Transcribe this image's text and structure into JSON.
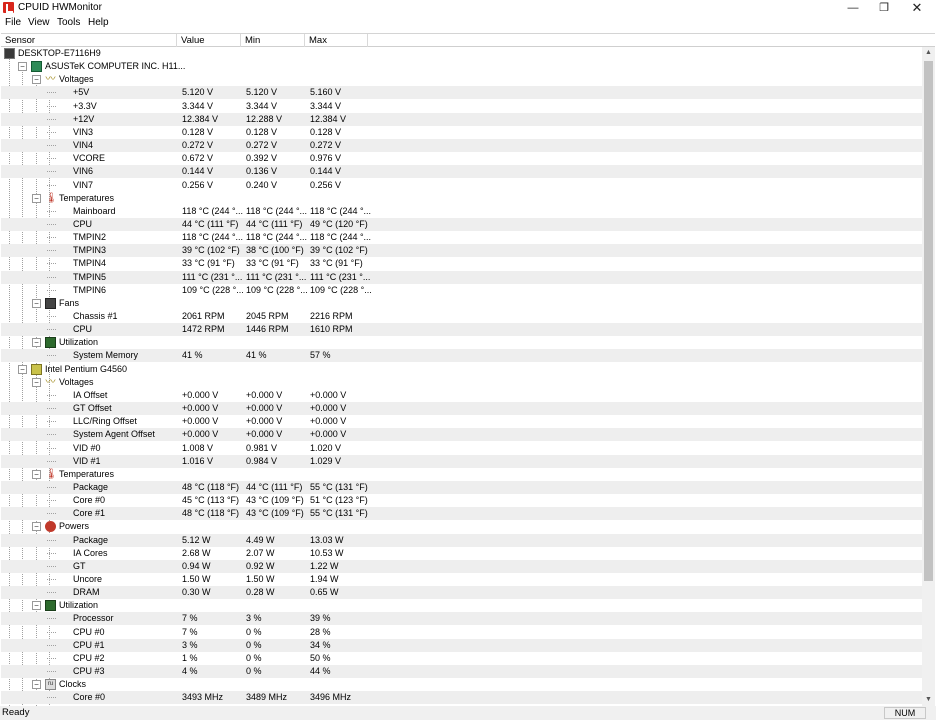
{
  "window": {
    "title": "CPUID HWMonitor",
    "minimize": "—",
    "maximize": "❐",
    "close": "✕"
  },
  "menu": [
    "File",
    "View",
    "Tools",
    "Help"
  ],
  "columns": [
    "Sensor",
    "Value",
    "Min",
    "Max"
  ],
  "rows": [
    {
      "d": 0,
      "k": "d",
      "ic": "pc",
      "l": "DESKTOP-E7116H9"
    },
    {
      "d": 1,
      "k": "d",
      "ic": "mb",
      "l": "ASUSTeK COMPUTER INC. H11..."
    },
    {
      "d": 2,
      "k": "g",
      "ic": "volt",
      "l": "Voltages"
    },
    {
      "d": 3,
      "k": "s",
      "l": "+5V",
      "v": "5.120 V",
      "mn": "5.120 V",
      "mx": "5.160 V"
    },
    {
      "d": 3,
      "k": "s",
      "l": "+3.3V",
      "v": "3.344 V",
      "mn": "3.344 V",
      "mx": "3.344 V"
    },
    {
      "d": 3,
      "k": "s",
      "l": "+12V",
      "v": "12.384 V",
      "mn": "12.288 V",
      "mx": "12.384 V"
    },
    {
      "d": 3,
      "k": "s",
      "l": "VIN3",
      "v": "0.128 V",
      "mn": "0.128 V",
      "mx": "0.128 V"
    },
    {
      "d": 3,
      "k": "s",
      "l": "VIN4",
      "v": "0.272 V",
      "mn": "0.272 V",
      "mx": "0.272 V"
    },
    {
      "d": 3,
      "k": "s",
      "l": "VCORE",
      "v": "0.672 V",
      "mn": "0.392 V",
      "mx": "0.976 V"
    },
    {
      "d": 3,
      "k": "s",
      "l": "VIN6",
      "v": "0.144 V",
      "mn": "0.136 V",
      "mx": "0.144 V"
    },
    {
      "d": 3,
      "k": "s",
      "l": "VIN7",
      "v": "0.256 V",
      "mn": "0.240 V",
      "mx": "0.256 V"
    },
    {
      "d": 2,
      "k": "g",
      "ic": "temp",
      "l": "Temperatures"
    },
    {
      "d": 3,
      "k": "s",
      "l": "Mainboard",
      "v": "118 °C (244 °...",
      "mn": "118 °C (244 °...",
      "mx": "118 °C (244 °..."
    },
    {
      "d": 3,
      "k": "s",
      "l": "CPU",
      "v": "44 °C (111 °F)",
      "mn": "44 °C (111 °F)",
      "mx": "49 °C (120 °F)"
    },
    {
      "d": 3,
      "k": "s",
      "l": "TMPIN2",
      "v": "118 °C (244 °...",
      "mn": "118 °C (244 °...",
      "mx": "118 °C (244 °..."
    },
    {
      "d": 3,
      "k": "s",
      "l": "TMPIN3",
      "v": "39 °C (102 °F)",
      "mn": "38 °C (100 °F)",
      "mx": "39 °C (102 °F)"
    },
    {
      "d": 3,
      "k": "s",
      "l": "TMPIN4",
      "v": "33 °C (91 °F)",
      "mn": "33 °C (91 °F)",
      "mx": "33 °C (91 °F)"
    },
    {
      "d": 3,
      "k": "s",
      "l": "TMPIN5",
      "v": "111 °C (231 °...",
      "mn": "111 °C (231 °...",
      "mx": "111 °C (231 °..."
    },
    {
      "d": 3,
      "k": "s",
      "l": "TMPIN6",
      "v": "109 °C (228 °...",
      "mn": "109 °C (228 °...",
      "mx": "109 °C (228 °..."
    },
    {
      "d": 2,
      "k": "g",
      "ic": "fan",
      "l": "Fans"
    },
    {
      "d": 3,
      "k": "s",
      "l": "Chassis #1",
      "v": "2061 RPM",
      "mn": "2045 RPM",
      "mx": "2216 RPM"
    },
    {
      "d": 3,
      "k": "s",
      "l": "CPU",
      "v": "1472 RPM",
      "mn": "1446 RPM",
      "mx": "1610 RPM"
    },
    {
      "d": 2,
      "k": "g",
      "ic": "util",
      "l": "Utilization"
    },
    {
      "d": 3,
      "k": "s",
      "l": "System Memory",
      "v": "41 %",
      "mn": "41 %",
      "mx": "57 %"
    },
    {
      "d": 1,
      "k": "d",
      "ic": "cpu",
      "l": "Intel Pentium G4560"
    },
    {
      "d": 2,
      "k": "g",
      "ic": "volt",
      "l": "Voltages"
    },
    {
      "d": 3,
      "k": "s",
      "l": "IA Offset",
      "v": "+0.000 V",
      "mn": "+0.000 V",
      "mx": "+0.000 V"
    },
    {
      "d": 3,
      "k": "s",
      "l": "GT Offset",
      "v": "+0.000 V",
      "mn": "+0.000 V",
      "mx": "+0.000 V"
    },
    {
      "d": 3,
      "k": "s",
      "l": "LLC/Ring Offset",
      "v": "+0.000 V",
      "mn": "+0.000 V",
      "mx": "+0.000 V"
    },
    {
      "d": 3,
      "k": "s",
      "l": "System Agent Offset",
      "v": "+0.000 V",
      "mn": "+0.000 V",
      "mx": "+0.000 V"
    },
    {
      "d": 3,
      "k": "s",
      "l": "VID #0",
      "v": "1.008 V",
      "mn": "0.981 V",
      "mx": "1.020 V"
    },
    {
      "d": 3,
      "k": "s",
      "l": "VID #1",
      "v": "1.016 V",
      "mn": "0.984 V",
      "mx": "1.029 V"
    },
    {
      "d": 2,
      "k": "g",
      "ic": "temp",
      "l": "Temperatures"
    },
    {
      "d": 3,
      "k": "s",
      "l": "Package",
      "v": "48 °C (118 °F)",
      "mn": "44 °C (111 °F)",
      "mx": "55 °C (131 °F)"
    },
    {
      "d": 3,
      "k": "s",
      "l": "Core #0",
      "v": "45 °C (113 °F)",
      "mn": "43 °C (109 °F)",
      "mx": "51 °C (123 °F)"
    },
    {
      "d": 3,
      "k": "s",
      "l": "Core #1",
      "v": "48 °C (118 °F)",
      "mn": "43 °C (109 °F)",
      "mx": "55 °C (131 °F)"
    },
    {
      "d": 2,
      "k": "g",
      "ic": "power",
      "l": "Powers"
    },
    {
      "d": 3,
      "k": "s",
      "l": "Package",
      "v": "5.12 W",
      "mn": "4.49 W",
      "mx": "13.03 W"
    },
    {
      "d": 3,
      "k": "s",
      "l": "IA Cores",
      "v": "2.68 W",
      "mn": "2.07 W",
      "mx": "10.53 W"
    },
    {
      "d": 3,
      "k": "s",
      "l": "GT",
      "v": "0.94 W",
      "mn": "0.92 W",
      "mx": "1.22 W"
    },
    {
      "d": 3,
      "k": "s",
      "l": "Uncore",
      "v": "1.50 W",
      "mn": "1.50 W",
      "mx": "1.94 W"
    },
    {
      "d": 3,
      "k": "s",
      "l": "DRAM",
      "v": "0.30 W",
      "mn": "0.28 W",
      "mx": "0.65 W"
    },
    {
      "d": 2,
      "k": "g",
      "ic": "util",
      "l": "Utilization"
    },
    {
      "d": 3,
      "k": "s",
      "l": "Processor",
      "v": "7 %",
      "mn": "3 %",
      "mx": "39 %"
    },
    {
      "d": 3,
      "k": "s",
      "l": "CPU #0",
      "v": "7 %",
      "mn": "0 %",
      "mx": "28 %"
    },
    {
      "d": 3,
      "k": "s",
      "l": "CPU #1",
      "v": "3 %",
      "mn": "0 %",
      "mx": "34 %"
    },
    {
      "d": 3,
      "k": "s",
      "l": "CPU #2",
      "v": "1 %",
      "mn": "0 %",
      "mx": "50 %"
    },
    {
      "d": 3,
      "k": "s",
      "l": "CPU #3",
      "v": "4 %",
      "mn": "0 %",
      "mx": "44 %"
    },
    {
      "d": 2,
      "k": "g",
      "ic": "clock",
      "l": "Clocks"
    },
    {
      "d": 3,
      "k": "s",
      "l": "Core #0",
      "v": "3493 MHz",
      "mn": "3489 MHz",
      "mx": "3496 MHz"
    }
  ],
  "status": {
    "text": "Ready",
    "num": "NUM"
  },
  "colors": {
    "alt_row": "#eeeeee",
    "accent": "#d8261c"
  }
}
